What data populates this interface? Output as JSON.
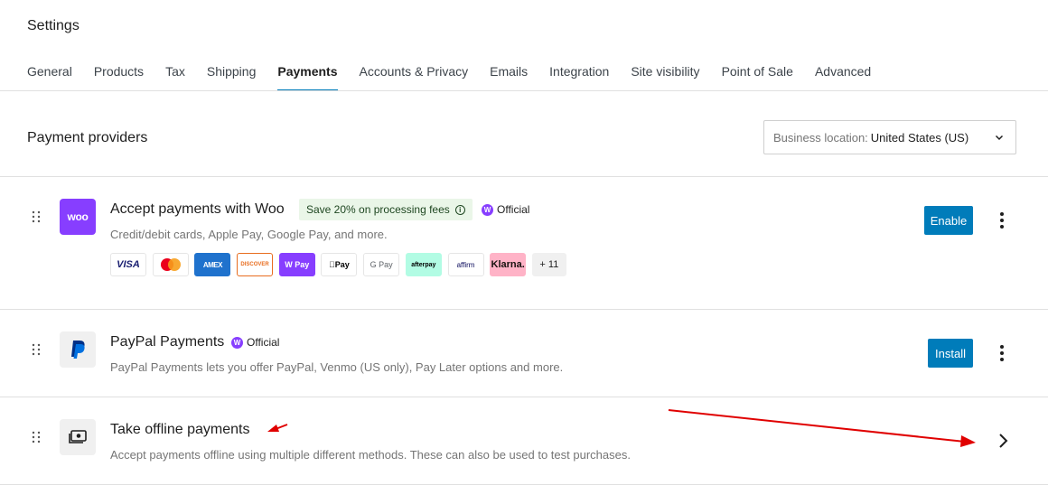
{
  "page": {
    "title": "Settings"
  },
  "tabs": [
    {
      "label": "General"
    },
    {
      "label": "Products"
    },
    {
      "label": "Tax"
    },
    {
      "label": "Shipping"
    },
    {
      "label": "Payments",
      "active": true
    },
    {
      "label": "Accounts & Privacy"
    },
    {
      "label": "Emails"
    },
    {
      "label": "Integration"
    },
    {
      "label": "Site visibility"
    },
    {
      "label": "Point of Sale"
    },
    {
      "label": "Advanced"
    }
  ],
  "section": {
    "title": "Payment providers"
  },
  "location": {
    "label": "Business location:",
    "value": "United States (US)"
  },
  "providers": {
    "woo": {
      "logo_text": "woo",
      "title": "Accept payments with Woo",
      "promo": "Save 20% on processing fees",
      "official": "Official",
      "description": "Credit/debit cards, Apple Pay, Google Pay, and more.",
      "methods": {
        "visa": "VISA",
        "amex": "AMEX",
        "discover": "DISCOVER",
        "wpay": "Pay",
        "apay": "Pay",
        "gpay": "G Pay",
        "afterpay": "afterpay",
        "affirm": "affirm",
        "klarna": "Klarna.",
        "more": "+ 11"
      },
      "button": "Enable"
    },
    "paypal": {
      "title": "PayPal Payments",
      "official": "Official",
      "description": "PayPal Payments lets you offer PayPal, Venmo (US only), Pay Later options and more.",
      "button": "Install"
    },
    "offline": {
      "title": "Take offline payments",
      "description": "Accept payments offline using multiple different methods. These can also be used to test purchases."
    }
  },
  "colors": {
    "accent": "#007cba",
    "woo_purple": "#873eff",
    "annotation": "#e00000"
  }
}
